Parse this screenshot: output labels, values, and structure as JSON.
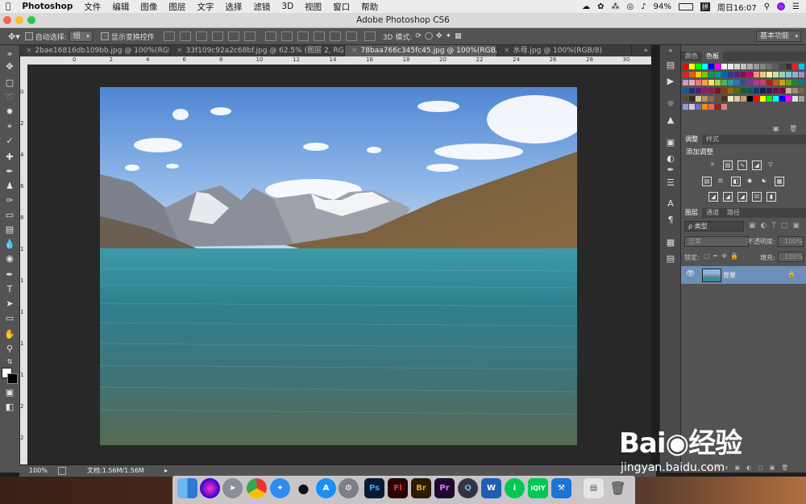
{
  "menubar": {
    "apple": "",
    "app_name": "Photoshop",
    "items": [
      "文件",
      "编辑",
      "图像",
      "图层",
      "文字",
      "选择",
      "滤镜",
      "3D",
      "视图",
      "窗口",
      "帮助"
    ],
    "battery": "94%",
    "input_method": "拼",
    "clock": "周日16:07"
  },
  "window": {
    "title": "Adobe Photoshop CS6"
  },
  "options": {
    "auto_select_label": "自动选择:",
    "auto_select_value": "组",
    "show_transform_label": "显示变换控件",
    "mode_3d_label": "3D 模式:",
    "workspace": "基本功能"
  },
  "tabs": [
    {
      "label": "2bae16816db109bb.jpg @ 100%(RGB/8)"
    },
    {
      "label": "33f109c92a2c68bf.jpg @ 62.5% (图层 2, RGB/8#) *"
    },
    {
      "label": "78baa766c345fc45.jpg @ 100%(RGB/8)"
    },
    {
      "label": "水母.jpg @ 100%(RGB/8)"
    }
  ],
  "ruler": {
    "h": [
      "0",
      "2",
      "4",
      "6",
      "8",
      "10",
      "12",
      "14",
      "16",
      "18",
      "20",
      "22",
      "24",
      "26",
      "28",
      "30",
      "32"
    ],
    "v": [
      "0",
      "2",
      "4",
      "6",
      "8",
      "1",
      "1",
      "1",
      "1",
      "1",
      "2",
      "2"
    ]
  },
  "status": {
    "zoom": "100%",
    "doc": "文档:1.56M/1.56M"
  },
  "panels": {
    "color_tabs": [
      "颜色",
      "色板"
    ],
    "adjust_tabs": [
      "调整",
      "样式"
    ],
    "add_adjustment": "添加调整",
    "layer_tabs": [
      "图层",
      "通道",
      "路径"
    ],
    "kind_filter": "ρ 类型",
    "blend_mode": "正常",
    "opacity_label": "不透明度:",
    "opacity_value": "100%",
    "lock_label": "锁定:",
    "fill_label": "填充:",
    "fill_value": "100%",
    "layer_name": "背景"
  },
  "dock": {
    "items": [
      "Finder",
      "Siri",
      "Launchpad",
      "Chrome",
      "Safari",
      "QQ",
      "App Store",
      "System Preferences",
      "Ps",
      "Fl",
      "Br",
      "Pr",
      "QuickTime",
      "Word",
      "iQIYI-1",
      "iQIYI-2",
      "Xcode",
      "Preview",
      "Trash"
    ],
    "labels": {
      "ps": "Ps",
      "fl": "Fl",
      "br": "Br",
      "pr": "Pr",
      "w": "W",
      "iq": "iQIY"
    }
  },
  "watermark": {
    "brand": "Bai",
    "brand_cn": "经验",
    "url": "jingyan.baidu.com"
  },
  "colors": {
    "accent": "#1b6ac9",
    "panel": "#535353",
    "canvas": "#282828"
  }
}
